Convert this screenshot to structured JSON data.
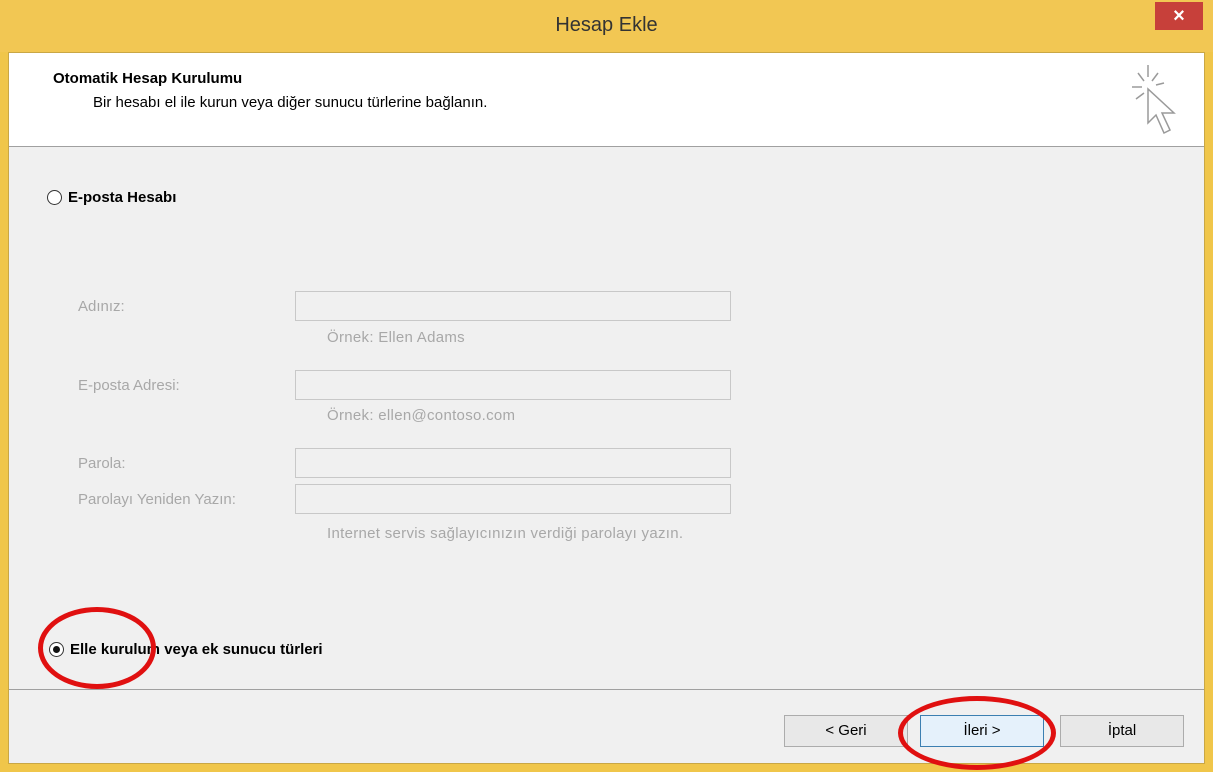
{
  "window": {
    "title": "Hesap Ekle",
    "close_label": "×"
  },
  "header": {
    "title": "Otomatik Hesap Kurulumu",
    "subtitle": "Bir hesabı el ile kurun veya diğer sunucu türlerine bağlanın."
  },
  "options": {
    "email_account": {
      "label": "E-posta Hesabı",
      "selected": false
    },
    "manual_setup": {
      "label": "Elle kurulum veya ek sunucu türleri",
      "selected": true
    }
  },
  "form": {
    "name_label": "Adınız:",
    "name_value": "",
    "name_hint": "Örnek: Ellen Adams",
    "email_label": "E-posta Adresi:",
    "email_value": "",
    "email_hint": "Örnek: ellen@contoso.com",
    "password_label": "Parola:",
    "password_value": "",
    "retype_label": "Parolayı Yeniden Yazın:",
    "retype_value": "",
    "password_hint": "Internet servis sağlayıcınızın verdiği parolayı yazın."
  },
  "buttons": {
    "back": "< Geri",
    "next": "İleri >",
    "cancel": "İptal"
  },
  "colors": {
    "titlebar": "#f2c753",
    "close_button": "#c7403a",
    "annotation": "#e01010"
  }
}
